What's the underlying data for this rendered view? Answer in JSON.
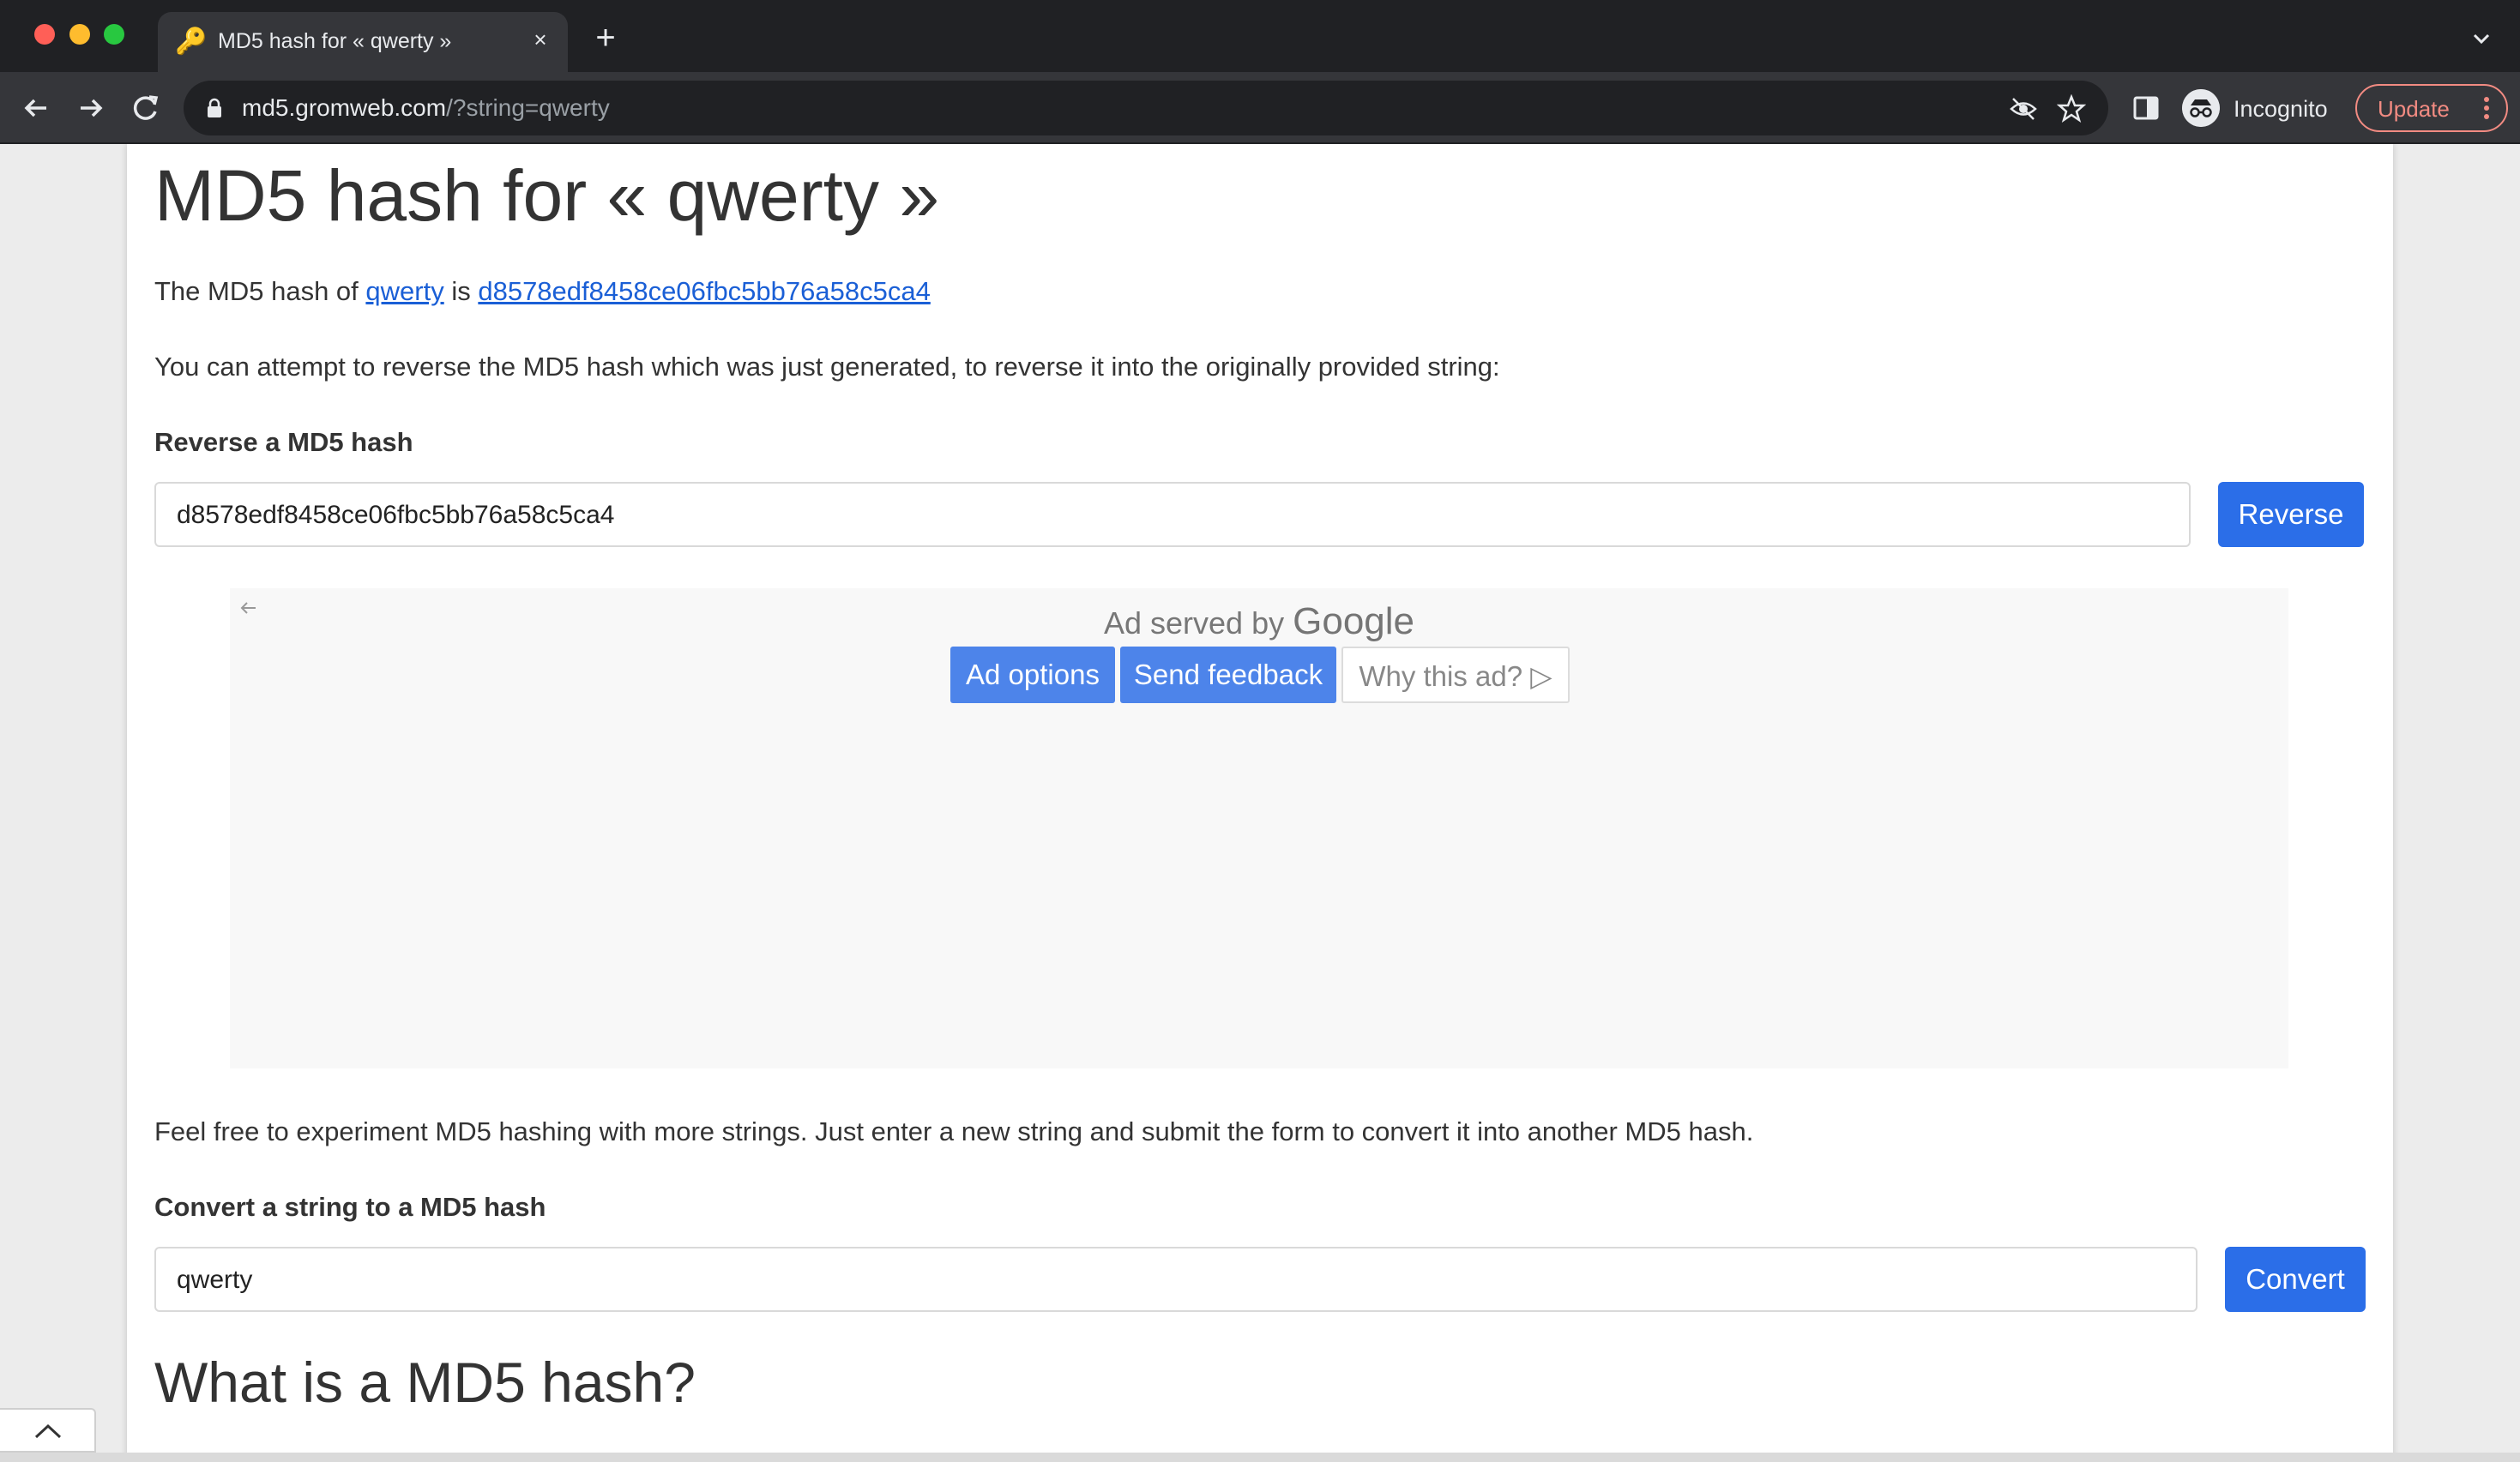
{
  "browser": {
    "tab_title": "MD5 hash for « qwerty »",
    "tab_close": "×",
    "new_tab": "+",
    "url_host": "md5.gromweb.com",
    "url_rest": "/?string=qwerty",
    "profile_label": "Incognito",
    "update_label": "Update",
    "icons": [
      "close-icon",
      "plus-icon",
      "back-icon",
      "forward-icon",
      "reload-icon",
      "lock-icon",
      "eye-off-icon",
      "star-icon",
      "side-panel-icon",
      "incognito-icon",
      "more-vert-icon",
      "chevron-down-icon"
    ]
  },
  "page": {
    "title": "MD5 hash for « qwerty »",
    "intro": {
      "prefix": "The MD5 hash of ",
      "string_link": "qwerty",
      "middle": " is ",
      "hash_link": "d8578edf8458ce06fbc5bb76a58c5ca4"
    },
    "reverse_text": "You can attempt to reverse the MD5 hash which was just generated, to reverse it into the originally provided string:",
    "reverse_form": {
      "label": "Reverse a MD5 hash",
      "value": "d8578edf8458ce06fbc5bb76a58c5ca4",
      "button": "Reverse"
    },
    "ad": {
      "served_by": "Ad served by",
      "brand": "Google",
      "options": "Ad options",
      "feedback": "Send feedback",
      "why": "Why this ad?"
    },
    "convert_text": "Feel free to experiment MD5 hashing with more strings. Just enter a new string and submit the form to convert it into another MD5 hash.",
    "convert_form": {
      "label": "Convert a string to a MD5 hash",
      "value": "qwerty",
      "button": "Convert"
    },
    "section_heading": "What is a MD5 hash?"
  },
  "colors": {
    "link": "#1a5fd6",
    "button": "#2b6ee8",
    "ad_button": "#4d84ea",
    "update": "#f28b82"
  }
}
